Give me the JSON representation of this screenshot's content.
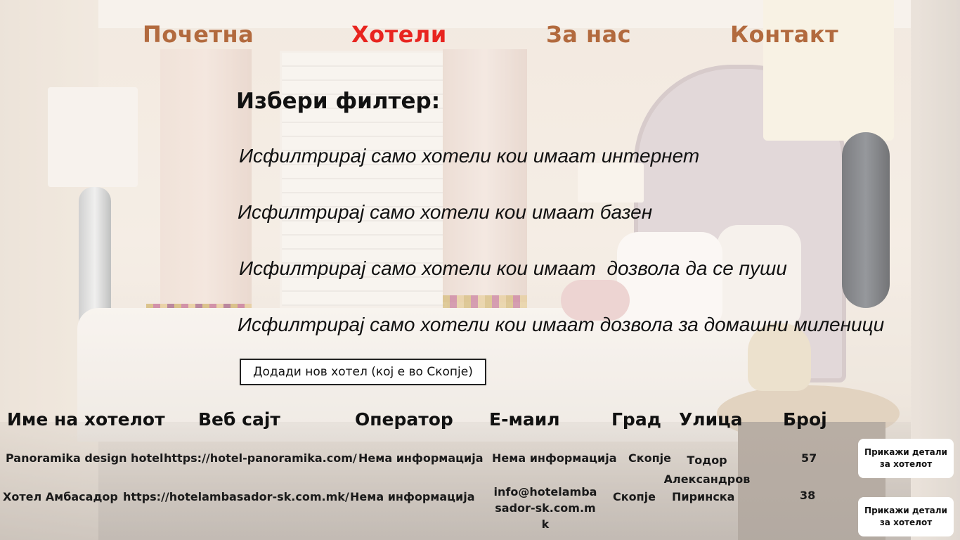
{
  "nav": {
    "home": "Почетна",
    "hotels": "Хотели",
    "about": "За нас",
    "contact": "Контакт"
  },
  "filters": {
    "title": "Избери филтер:",
    "options": [
      "Исфилтрирај само хотели кои имаат интернет",
      "Исфилтрирај само хотели кои имаат базен",
      "Исфилтрирај само хотели кои имаат  дозвола да се пуши",
      "Исфилтрирај само хотели кои имаат дозвола за домашни миленици"
    ]
  },
  "add_hotel_button": "Додади нов хотел (кој е во Скопје)",
  "table": {
    "headers": [
      "Име на хотелот",
      "Веб сајт",
      "Оператор",
      "Е-маил",
      "Град",
      "Улица",
      "Број"
    ],
    "rows": [
      {
        "name": "Panoramika design hotel",
        "website": "https://hotel-panoramika.com/",
        "operator": "Нема информација",
        "email": "Нема информација",
        "city": "Скопје",
        "street": "Тодор Александров",
        "number": "57",
        "details_button": "Прикажи детали за хотелот"
      },
      {
        "name": "Хотел Амбасадор",
        "website": "https://hotelambasador-sk.com.mk/",
        "operator": "Нема информација",
        "email": "info@hotelambasador-sk.com.mk",
        "city": "Скопје",
        "street": "Пиринска",
        "number": "38",
        "details_button": "Прикажи детали за хотелот"
      }
    ]
  },
  "colors": {
    "nav_text": "#b26a3e",
    "nav_active": "#e8241f",
    "text": "#111111"
  }
}
